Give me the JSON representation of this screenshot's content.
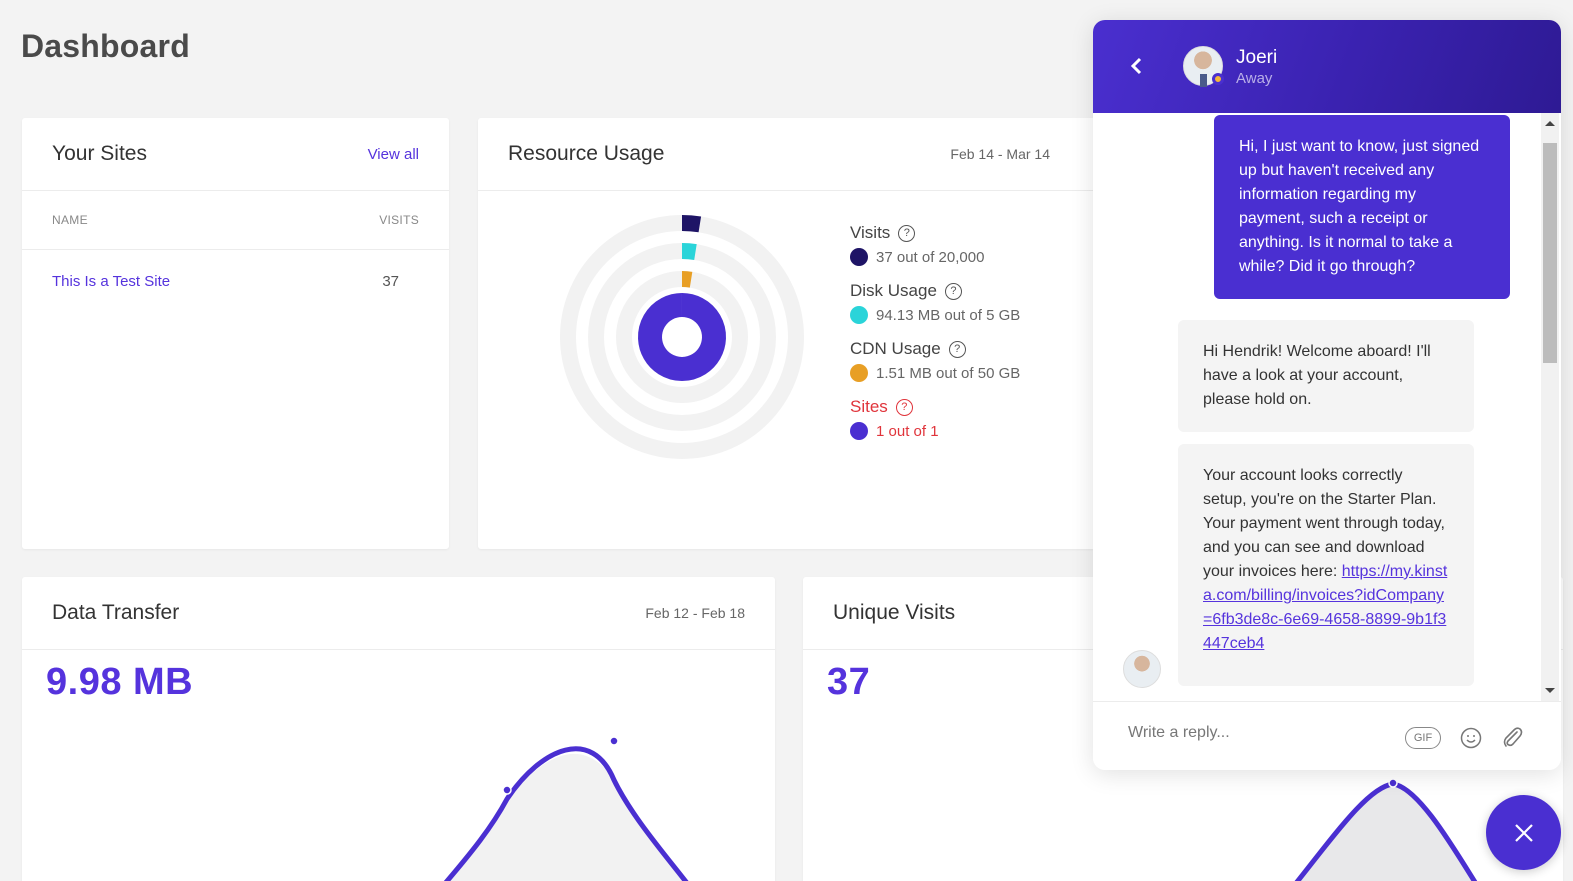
{
  "page": {
    "title": "Dashboard"
  },
  "sites": {
    "title": "Your Sites",
    "view_all": "View all",
    "columns": [
      "NAME",
      "VISITS"
    ],
    "rows": [
      {
        "name": "This Is a Test Site",
        "visits": "37"
      }
    ]
  },
  "resource": {
    "title": "Resource Usage",
    "date_range": "Feb 14 - Mar 14",
    "items": [
      {
        "label": "Visits",
        "value": "37 out of 20,000",
        "color": "#1e1466",
        "fraction": 0.00185
      },
      {
        "label": "Disk Usage",
        "value": "94.13 MB out of 5 GB",
        "color": "#2ad4d9",
        "fraction": 0.0184
      },
      {
        "label": "CDN Usage",
        "value": "1.51 MB out of 50 GB",
        "color": "#e89f25",
        "fraction": 3e-05
      },
      {
        "label": "Sites",
        "value": "1 out of 1",
        "color": "#4a2fd1",
        "fraction": 1.0,
        "alert": true
      }
    ],
    "help_glyph": "?"
  },
  "transfer": {
    "title": "Data Transfer",
    "date_range": "Feb 12 - Feb 18",
    "total": "9.98 MB"
  },
  "unique": {
    "title": "Unique Visits",
    "total": "37"
  },
  "chat": {
    "agent_name": "Joeri",
    "agent_status": "Away",
    "back_glyph": "‹",
    "messages": [
      {
        "from": "user",
        "text": "Hi, I just want to know, just signed up but haven't received any information regarding my payment, such a receipt or anything. Is it normal to take a while? Did it go through?"
      },
      {
        "from": "agent",
        "text": "Hi Hendrik! Welcome aboard! I'll have a look at your account, please hold on."
      },
      {
        "from": "agent",
        "text": "Your account looks correctly setup, you're on the Starter Plan. Your payment went through today, and you can see and download your invoices here:",
        "link": "https://my.kinsta.com/billing/invoices?idCompany=6fb3de8c-6e69-4658-8899-9b1f3447ceb4"
      }
    ],
    "reply_placeholder": "Write a reply...",
    "gif_label": "GIF"
  },
  "colors": {
    "accent": "#4a2fd1",
    "alert": "#e0343b"
  }
}
